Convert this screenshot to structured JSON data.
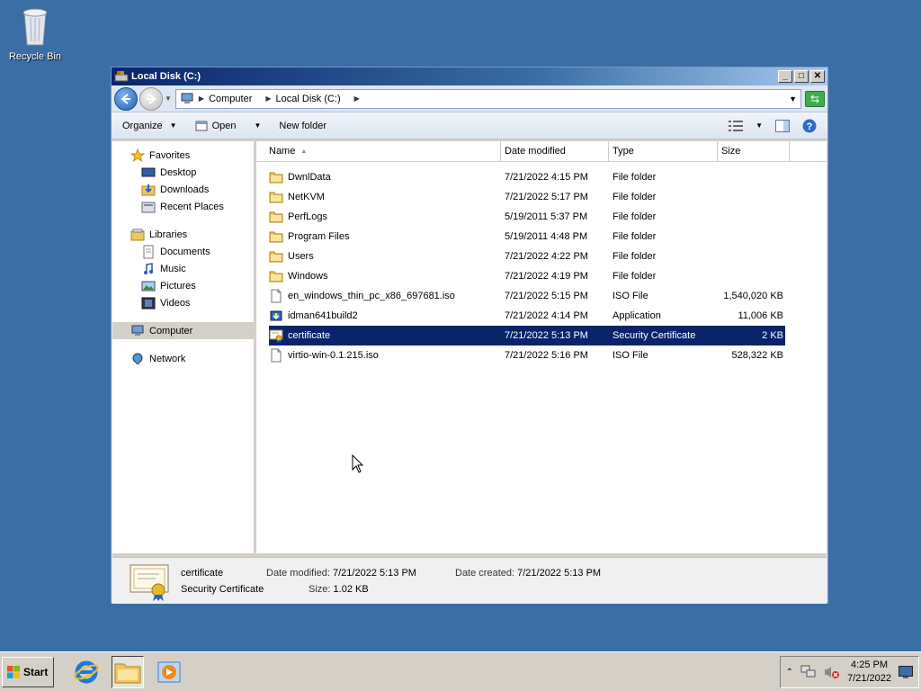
{
  "desktop": {
    "recycle_bin_label": "Recycle Bin"
  },
  "window": {
    "title": "Local Disk (C:)",
    "controls": {
      "minimize": "_",
      "maximize": "□",
      "close": "✕"
    }
  },
  "address": {
    "crumbs": [
      "Computer",
      "Local Disk (C:)"
    ]
  },
  "toolbar": {
    "organize": "Organize",
    "open": "Open",
    "new_folder": "New folder"
  },
  "navpane": {
    "favorites": {
      "label": "Favorites",
      "items": [
        "Desktop",
        "Downloads",
        "Recent Places"
      ]
    },
    "libraries": {
      "label": "Libraries",
      "items": [
        "Documents",
        "Music",
        "Pictures",
        "Videos"
      ]
    },
    "computer": "Computer",
    "network": "Network"
  },
  "columns": {
    "name": "Name",
    "date": "Date modified",
    "type": "Type",
    "size": "Size"
  },
  "files": [
    {
      "name": "DwnlData",
      "date": "7/21/2022 4:15 PM",
      "type": "File folder",
      "size": "",
      "icon": "folder-icon"
    },
    {
      "name": "NetKVM",
      "date": "7/21/2022 5:17 PM",
      "type": "File folder",
      "size": "",
      "icon": "folder-icon"
    },
    {
      "name": "PerfLogs",
      "date": "5/19/2011 5:37 PM",
      "type": "File folder",
      "size": "",
      "icon": "folder-icon"
    },
    {
      "name": "Program Files",
      "date": "5/19/2011 4:48 PM",
      "type": "File folder",
      "size": "",
      "icon": "folder-icon"
    },
    {
      "name": "Users",
      "date": "7/21/2022 4:22 PM",
      "type": "File folder",
      "size": "",
      "icon": "folder-icon"
    },
    {
      "name": "Windows",
      "date": "7/21/2022 4:19 PM",
      "type": "File folder",
      "size": "",
      "icon": "folder-icon"
    },
    {
      "name": "en_windows_thin_pc_x86_697681.iso",
      "date": "7/21/2022 5:15 PM",
      "type": "ISO File",
      "size": "1,540,020 KB",
      "icon": "file-icon"
    },
    {
      "name": "idman641build2",
      "date": "7/21/2022 4:14 PM",
      "type": "Application",
      "size": "11,006 KB",
      "icon": "app-icon"
    },
    {
      "name": "certificate",
      "date": "7/21/2022 5:13 PM",
      "type": "Security Certificate",
      "size": "2 KB",
      "icon": "certificate-icon"
    },
    {
      "name": "virtio-win-0.1.215.iso",
      "date": "7/21/2022 5:16 PM",
      "type": "ISO File",
      "size": "528,322 KB",
      "icon": "file-icon"
    }
  ],
  "details": {
    "name": "certificate",
    "type": "Security Certificate",
    "modified_label": "Date modified:",
    "modified": "7/21/2022 5:13 PM",
    "created_label": "Date created:",
    "created": "7/21/2022 5:13 PM",
    "size_label": "Size:",
    "size": "1.02 KB"
  },
  "taskbar": {
    "start_label": "Start",
    "clock_time": "4:25 PM",
    "clock_date": "7/21/2022"
  },
  "colors": {
    "desktop": "#3a6ea5",
    "selection": "#0a246a",
    "titlebar": "#0a246a"
  }
}
